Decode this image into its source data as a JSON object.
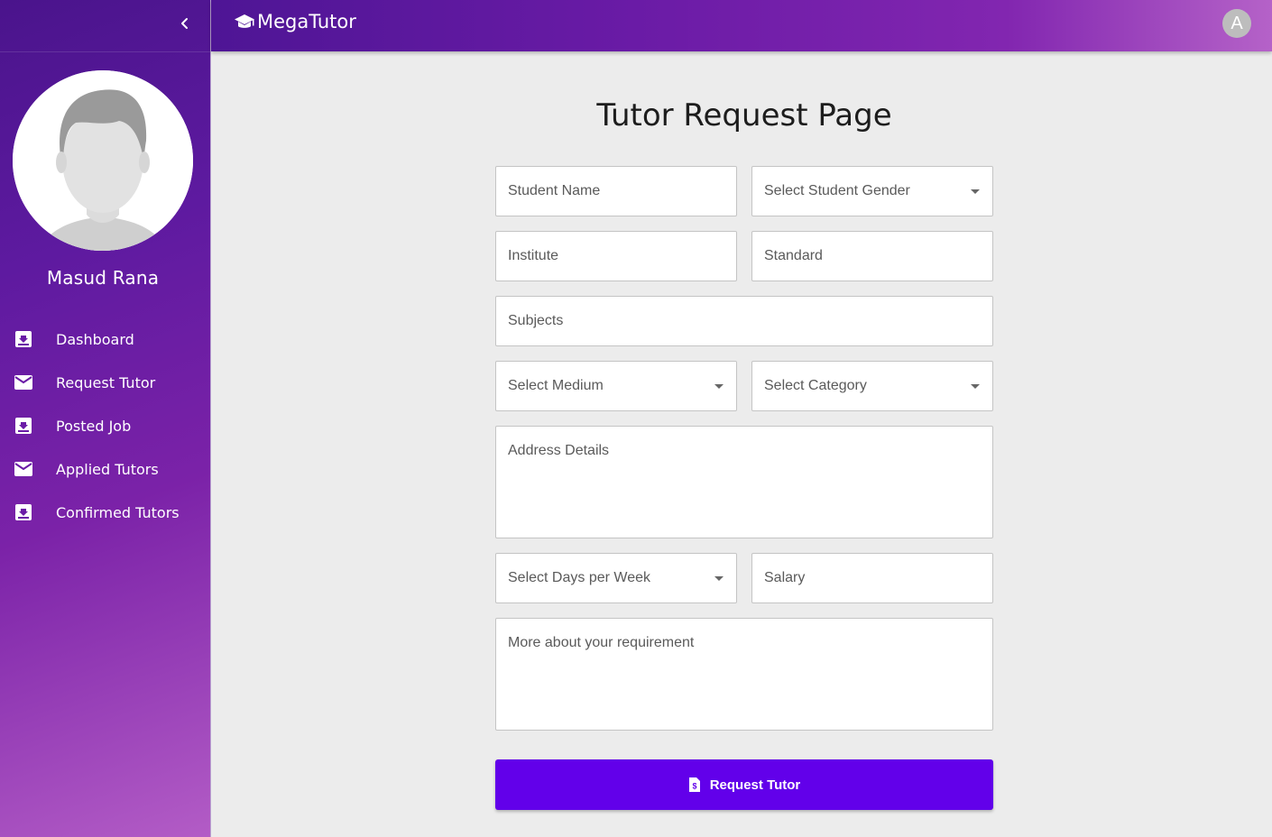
{
  "brand": {
    "name": "MegaTutor",
    "icon": "graduation-cap-icon"
  },
  "header": {
    "account_initial": "A"
  },
  "sidebar": {
    "user_name": "Masud Rana",
    "items": [
      {
        "label": "Dashboard",
        "icon": "inbox-download-icon"
      },
      {
        "label": "Request Tutor",
        "icon": "mail-icon"
      },
      {
        "label": "Posted Job",
        "icon": "inbox-download-icon"
      },
      {
        "label": "Applied Tutors",
        "icon": "mail-icon"
      },
      {
        "label": "Confirmed Tutors",
        "icon": "inbox-download-icon"
      }
    ]
  },
  "page": {
    "title": "Tutor Request Page"
  },
  "form": {
    "student_name": "Student Name",
    "student_gender": "Select Student Gender",
    "institute": "Institute",
    "standard": "Standard",
    "subjects": "Subjects",
    "medium": "Select Medium",
    "category": "Select Category",
    "address": "Address Details",
    "days_per_week": "Select Days per Week",
    "salary": "Salary",
    "requirement": "More about your requirement",
    "submit_label": "Request Tutor"
  },
  "colors": {
    "primary_button": "#6200ea",
    "sidebar_start": "#4a148c",
    "sidebar_end": "#b35cc6"
  }
}
